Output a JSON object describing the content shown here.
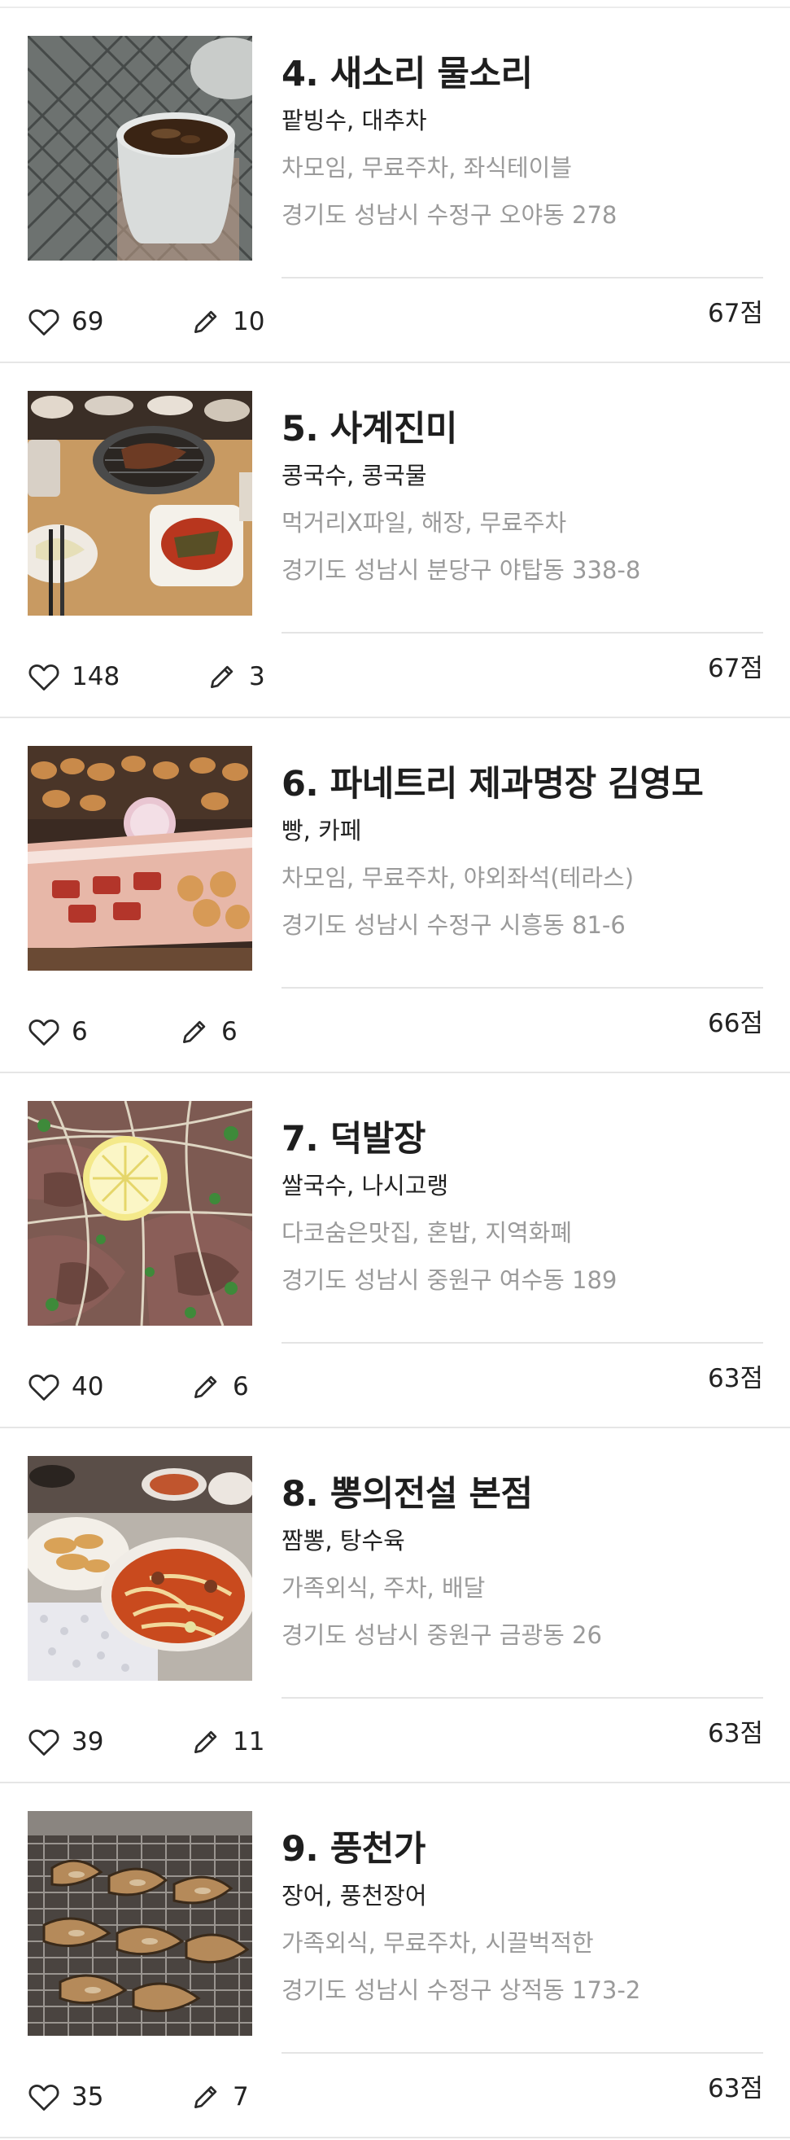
{
  "restaurants": [
    {
      "rank_title": "4. 새소리 물소리",
      "menu": "팥빙수, 대추차",
      "tags": "차모임, 무료주차, 좌식테이블",
      "address": "경기도 성남시 수정구 오야동 278",
      "likes": "69",
      "reviews": "10",
      "score": "67점",
      "photo": "tea-cup-photo"
    },
    {
      "rank_title": "5. 사계진미",
      "menu": "콩국수, 콩국물",
      "tags": "먹거리X파일, 해장, 무료주차",
      "address": "경기도 성남시 분당구 야탑동 338-8",
      "likes": "148",
      "reviews": "3",
      "score": "67점",
      "photo": "grill-table-photo"
    },
    {
      "rank_title": "6. 파네트리 제과명장 김영모",
      "menu": "빵, 카페",
      "tags": "차모임, 무료주차, 야외좌석(테라스)",
      "address": "경기도 성남시 수정구 시흥동 81-6",
      "likes": "6",
      "reviews": "6",
      "score": "66점",
      "photo": "bakery-display-photo"
    },
    {
      "rank_title": "7. 덕발장",
      "menu": "쌀국수, 나시고랭",
      "tags": "다코숨은맛집, 혼밥, 지역화폐",
      "address": "경기도 성남시 중원구 여수동 189",
      "likes": "40",
      "reviews": "6",
      "score": "63점",
      "photo": "pho-bowl-photo"
    },
    {
      "rank_title": "8. 뽕의전설 본점",
      "menu": "짬뽕, 탕수육",
      "tags": "가족외식, 주차, 배달",
      "address": "경기도 성남시 중원구 금광동 26",
      "likes": "39",
      "reviews": "11",
      "score": "63점",
      "photo": "jjamppong-photo"
    },
    {
      "rank_title": "9. 풍천가",
      "menu": "장어, 풍천장어",
      "tags": "가족외식, 무료주차, 시끌벅적한",
      "address": "경기도 성남시 수정구 상적동 173-2",
      "likes": "35",
      "reviews": "7",
      "score": "63점",
      "photo": "eel-grill-photo"
    }
  ]
}
